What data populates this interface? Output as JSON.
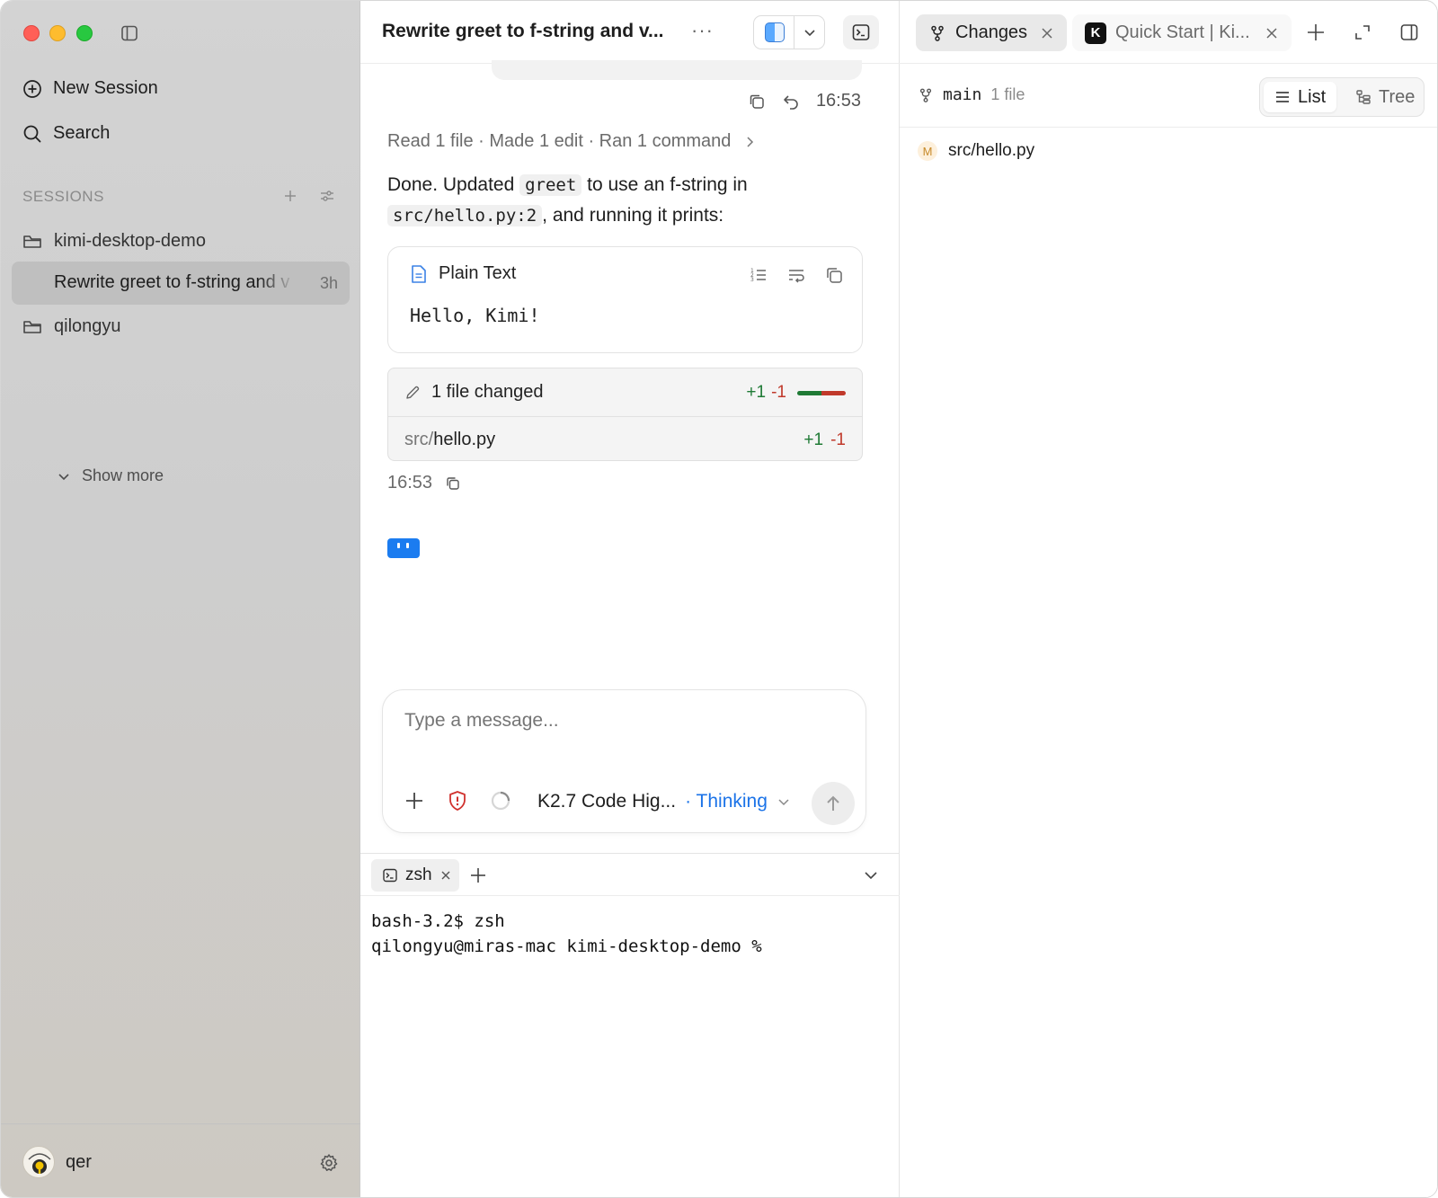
{
  "sidebar": {
    "new_session": "New Session",
    "search": "Search",
    "sessions_header": "SESSIONS",
    "projects": [
      {
        "name": "kimi-desktop-demo"
      },
      {
        "name": "qilongyu"
      }
    ],
    "active_session": {
      "title": "Rewrite greet to f-string and v",
      "age": "3h"
    },
    "show_more": "Show more",
    "user": {
      "name": "qer"
    }
  },
  "chat": {
    "title": "Rewrite greet to f-string and v...",
    "more_label": "···",
    "message_time": "16:53",
    "activity_summary": "Read 1 file · Made 1 edit · Ran 1 command",
    "answer": {
      "part1": "Done. Updated ",
      "code1": "greet",
      "part2": " to use an f-string in ",
      "code2": "src/hello.py:2",
      "part3": ", and running it prints:"
    },
    "code_block": {
      "language": "Plain Text",
      "content": "Hello, Kimi!"
    },
    "diff": {
      "summary": "1 file changed",
      "added": "+1",
      "removed": "-1",
      "file_dir": "src/",
      "file_name": "hello.py",
      "file_added": "+1",
      "file_removed": "-1"
    },
    "reply_time": "16:53"
  },
  "composer": {
    "placeholder": "Type a message...",
    "model": "K2.7 Code Hig...",
    "mode": "· Thinking"
  },
  "terminal": {
    "tab": "zsh",
    "lines": "bash-3.2$ zsh\nqilongyu@miras-mac kimi-desktop-demo %"
  },
  "right_panel": {
    "tabs": [
      {
        "label": "Changes",
        "active": true
      },
      {
        "label": "Quick Start | Ki...",
        "active": false
      }
    ],
    "branch": "main",
    "file_count": "1 file",
    "view_list": "List",
    "view_tree": "Tree",
    "files": [
      {
        "status": "M",
        "path": "src/hello.py"
      }
    ]
  },
  "colors": {
    "accent": "#1b73e8",
    "added": "#1f7a35",
    "removed": "#c0392b",
    "sidebar_bg": "#d0d0d0"
  },
  "icons": [
    "sidebar-toggle-icon",
    "plus-circle-icon",
    "search-icon",
    "new-session-icon",
    "filter-icon",
    "folder-icon",
    "chevron-down-icon",
    "gear-icon",
    "finder-icon",
    "terminal-icon",
    "copy-icon",
    "undo-icon",
    "chevron-right-icon",
    "file-text-icon",
    "line-numbers-icon",
    "wrap-icon",
    "pencil-icon",
    "plus-icon",
    "shield-alert-icon",
    "spinner-icon",
    "arrow-up-icon",
    "close-icon",
    "git-branch-icon",
    "expand-icon",
    "panel-icon",
    "list-icon",
    "tree-icon"
  ]
}
